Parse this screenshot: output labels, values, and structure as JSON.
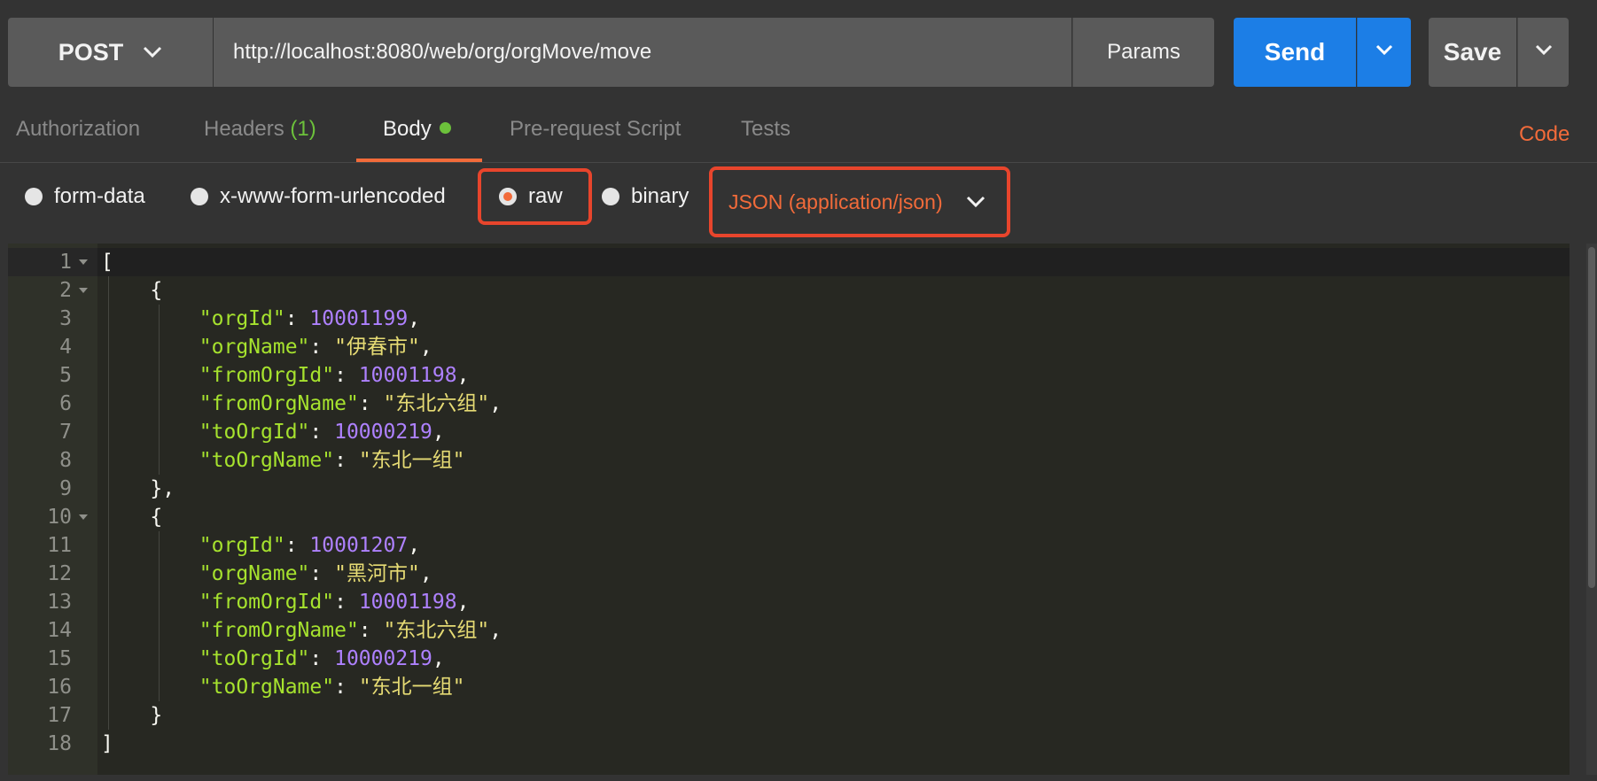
{
  "request": {
    "method": "POST",
    "url": "http://localhost:8080/web/org/orgMove/move",
    "params_label": "Params",
    "send_label": "Send",
    "save_label": "Save"
  },
  "tabs": [
    {
      "label": "Authorization"
    },
    {
      "label": "Headers",
      "count": "(1)"
    },
    {
      "label": "Body",
      "active": true
    },
    {
      "label": "Pre-request Script"
    },
    {
      "label": "Tests"
    }
  ],
  "code_link": "Code",
  "body_types": [
    {
      "label": "form-data",
      "checked": false
    },
    {
      "label": "x-www-form-urlencoded",
      "checked": false
    },
    {
      "label": "raw",
      "checked": true
    },
    {
      "label": "binary",
      "checked": false
    }
  ],
  "content_type": "JSON (application/json)",
  "editor": {
    "lines": [
      {
        "num": "1",
        "fold": true,
        "tokens": [
          [
            "p",
            "["
          ]
        ]
      },
      {
        "num": "2",
        "fold": true,
        "tokens": [
          [
            "p",
            "    {"
          ]
        ]
      },
      {
        "num": "3",
        "tokens": [
          [
            "p",
            "        "
          ],
          [
            "k",
            "\"orgId\""
          ],
          [
            "p",
            ": "
          ],
          [
            "n",
            "10001199"
          ],
          [
            "p",
            ","
          ]
        ]
      },
      {
        "num": "4",
        "tokens": [
          [
            "p",
            "        "
          ],
          [
            "k",
            "\"orgName\""
          ],
          [
            "p",
            ": "
          ],
          [
            "s",
            "\"伊春市\""
          ],
          [
            "p",
            ","
          ]
        ]
      },
      {
        "num": "5",
        "tokens": [
          [
            "p",
            "        "
          ],
          [
            "k",
            "\"fromOrgId\""
          ],
          [
            "p",
            ": "
          ],
          [
            "n",
            "10001198"
          ],
          [
            "p",
            ","
          ]
        ]
      },
      {
        "num": "6",
        "tokens": [
          [
            "p",
            "        "
          ],
          [
            "k",
            "\"fromOrgName\""
          ],
          [
            "p",
            ": "
          ],
          [
            "s",
            "\"东北六组\""
          ],
          [
            "p",
            ","
          ]
        ]
      },
      {
        "num": "7",
        "tokens": [
          [
            "p",
            "        "
          ],
          [
            "k",
            "\"toOrgId\""
          ],
          [
            "p",
            ": "
          ],
          [
            "n",
            "10000219"
          ],
          [
            "p",
            ","
          ]
        ]
      },
      {
        "num": "8",
        "tokens": [
          [
            "p",
            "        "
          ],
          [
            "k",
            "\"toOrgName\""
          ],
          [
            "p",
            ": "
          ],
          [
            "s",
            "\"东北一组\""
          ]
        ]
      },
      {
        "num": "9",
        "tokens": [
          [
            "p",
            "    },"
          ]
        ]
      },
      {
        "num": "10",
        "fold": true,
        "tokens": [
          [
            "p",
            "    {"
          ]
        ]
      },
      {
        "num": "11",
        "tokens": [
          [
            "p",
            "        "
          ],
          [
            "k",
            "\"orgId\""
          ],
          [
            "p",
            ": "
          ],
          [
            "n",
            "10001207"
          ],
          [
            "p",
            ","
          ]
        ]
      },
      {
        "num": "12",
        "tokens": [
          [
            "p",
            "        "
          ],
          [
            "k",
            "\"orgName\""
          ],
          [
            "p",
            ": "
          ],
          [
            "s",
            "\"黑河市\""
          ],
          [
            "p",
            ","
          ]
        ]
      },
      {
        "num": "13",
        "tokens": [
          [
            "p",
            "        "
          ],
          [
            "k",
            "\"fromOrgId\""
          ],
          [
            "p",
            ": "
          ],
          [
            "n",
            "10001198"
          ],
          [
            "p",
            ","
          ]
        ]
      },
      {
        "num": "14",
        "tokens": [
          [
            "p",
            "        "
          ],
          [
            "k",
            "\"fromOrgName\""
          ],
          [
            "p",
            ": "
          ],
          [
            "s",
            "\"东北六组\""
          ],
          [
            "p",
            ","
          ]
        ]
      },
      {
        "num": "15",
        "tokens": [
          [
            "p",
            "        "
          ],
          [
            "k",
            "\"toOrgId\""
          ],
          [
            "p",
            ": "
          ],
          [
            "n",
            "10000219"
          ],
          [
            "p",
            ","
          ]
        ]
      },
      {
        "num": "16",
        "tokens": [
          [
            "p",
            "        "
          ],
          [
            "k",
            "\"toOrgName\""
          ],
          [
            "p",
            ": "
          ],
          [
            "s",
            "\"东北一组\""
          ]
        ]
      },
      {
        "num": "17",
        "tokens": [
          [
            "p",
            "    }"
          ]
        ]
      },
      {
        "num": "18",
        "tokens": [
          [
            "p",
            "]"
          ]
        ]
      }
    ]
  }
}
